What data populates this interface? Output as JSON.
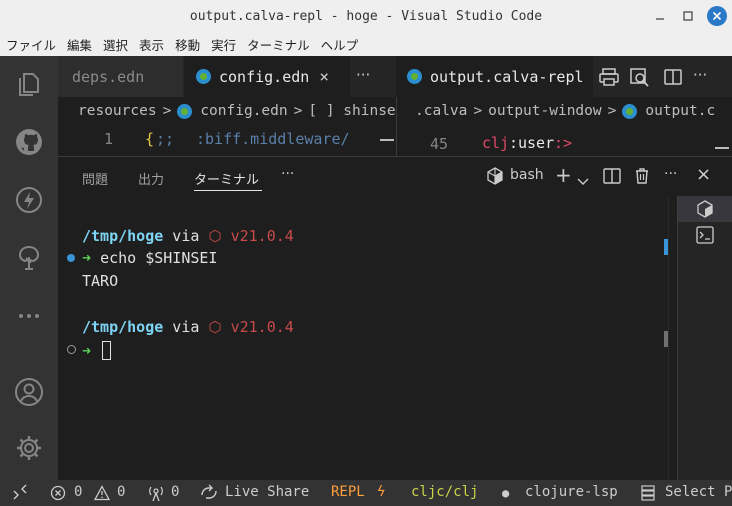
{
  "window": {
    "title": "output.calva-repl - hoge - Visual Studio Code"
  },
  "menu": [
    "ファイル",
    "編集",
    "選択",
    "表示",
    "移動",
    "実行",
    "ターミナル",
    "ヘルプ"
  ],
  "editor_left": {
    "tabs": [
      {
        "label": "deps.edn",
        "active": false
      },
      {
        "label": "config.edn",
        "active": true,
        "close": "×"
      }
    ],
    "more": "···",
    "breadcrumb": {
      "folder": "resources",
      "sep": ">",
      "file": "config.edn",
      "symbol": "[ ] shinse"
    },
    "line_number": "1",
    "code": {
      "open": "{",
      "comment": ";;",
      "keyword": ":biff.middleware/"
    }
  },
  "editor_right": {
    "tab": {
      "label": "output.calva-repl"
    },
    "breadcrumb": {
      "folder": ".calva",
      "sep": ">",
      "subfolder": "output-window",
      "file": "output.c"
    },
    "line_number": "45",
    "code": {
      "ns": "clj",
      "colon": ":",
      "user": "user",
      "arrow": ":>"
    }
  },
  "panel": {
    "tabs": [
      "問題",
      "出力",
      "ターミナル"
    ],
    "more": "···",
    "shell": "bash",
    "add": "+",
    "close": "×"
  },
  "terminal": {
    "lines": [
      {
        "path": "/tmp/hoge",
        "via": " via ",
        "node_icon": "⬡",
        "version": "v21.0.4"
      },
      {
        "arrow": "➜",
        "command": "echo $SHINSEI"
      },
      {
        "output": "TARO"
      },
      {
        "path": "/tmp/hoge",
        "via": " via ",
        "node_icon": "⬡",
        "version": "v21.0.4"
      },
      {
        "arrow": "➜",
        "command": ""
      }
    ]
  },
  "statusbar": {
    "errors": "0",
    "warnings": "0",
    "ports": "0",
    "live_share": "Live Share",
    "repl": "REPL",
    "repl_icon": "ϟ",
    "cljc": "cljc/clj",
    "dot": "●",
    "lsp": "clojure-lsp",
    "select": "Select P"
  },
  "colors": {
    "accent": "#2a78c8",
    "path": "#7fd4f5",
    "version": "#c84a4a",
    "prompt_arrow": "#5ad25a",
    "repl": "#ff9e3d",
    "cljc": "#c8d44a"
  }
}
